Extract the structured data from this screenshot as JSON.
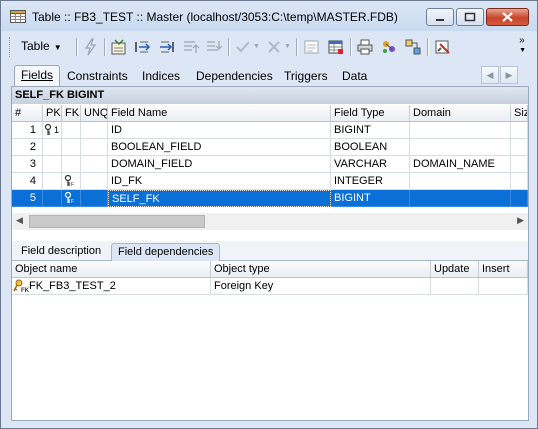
{
  "window": {
    "title": "Table :: FB3_TEST :: Master (localhost/3053:C:\\temp\\MASTER.FDB)",
    "icon": "table-icon",
    "buttons": [
      "minimize-icon",
      "maximize-icon",
      "close-icon"
    ]
  },
  "toolbar": {
    "table_label": "Table",
    "more": "»",
    "icons": [
      "lightning-icon",
      "edit-table-icon",
      "insert-field-icon",
      "append-field-icon",
      "move-up-icon",
      "move-down-icon",
      "commit-icon",
      "rollback-icon",
      "properties-icon",
      "grid-icon",
      "print-icon",
      "design-icon",
      "dependency-icon",
      "compile-icon"
    ]
  },
  "tabs": {
    "items": [
      "Fields",
      "Constraints",
      "Indices",
      "Dependencies",
      "Triggers",
      "Data"
    ],
    "active": "Fields"
  },
  "header_bar": "SELF_FK BIGINT",
  "fields_grid": {
    "columns": [
      "#",
      "PK",
      "FK",
      "UNQ",
      "Field Name",
      "Field Type",
      "Domain",
      "Siz"
    ],
    "rows": [
      {
        "num": "1",
        "pk": "key-icon",
        "pk_text": "1",
        "fk": "",
        "unq": "",
        "name": "ID",
        "type": "BIGINT",
        "domain": ""
      },
      {
        "num": "2",
        "pk": "",
        "pk_text": "",
        "fk": "",
        "unq": "",
        "name": "BOOLEAN_FIELD",
        "type": "BOOLEAN",
        "domain": ""
      },
      {
        "num": "3",
        "pk": "",
        "pk_text": "",
        "fk": "",
        "unq": "",
        "name": "DOMAIN_FIELD",
        "type": "VARCHAR",
        "domain": "DOMAIN_NAME"
      },
      {
        "num": "4",
        "pk": "",
        "pk_text": "",
        "fk": "foreign-key-icon",
        "unq": "",
        "name": "ID_FK",
        "type": "INTEGER",
        "domain": ""
      },
      {
        "num": "5",
        "pk": "",
        "pk_text": "",
        "fk": "foreign-key-icon",
        "unq": "",
        "name": "SELF_FK",
        "type": "BIGINT",
        "domain": ""
      }
    ],
    "selected_row": 5
  },
  "lower_tabs": {
    "items": [
      "Field description",
      "Field dependencies"
    ],
    "active": "Field dependencies"
  },
  "dependencies_grid": {
    "columns": [
      "Object name",
      "Object type",
      "Update",
      "Insert"
    ],
    "rows": [
      {
        "icon": "foreign-key-icon",
        "name": "FK_FB3_TEST_2",
        "type": "Foreign Key",
        "update": "",
        "insert": ""
      }
    ]
  },
  "colors": {
    "selection": "#0a6fd6",
    "title_bar": "#c9daf0",
    "close_button": "#c8452a"
  }
}
